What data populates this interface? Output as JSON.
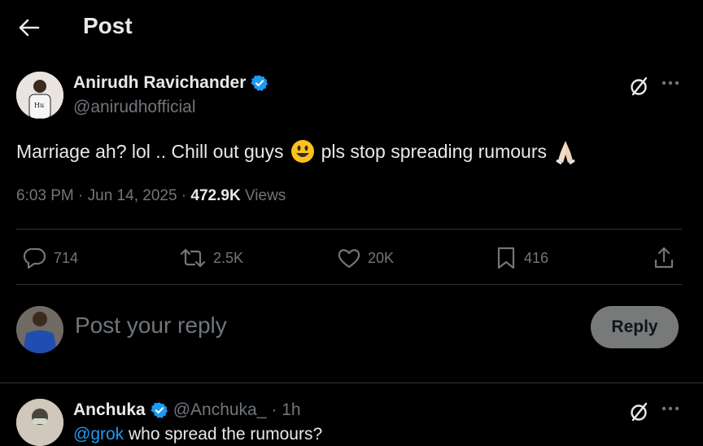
{
  "header": {
    "title": "Post",
    "back_icon": "arrow-left-icon"
  },
  "post": {
    "author_name": "Anirudh Ravichander",
    "author_handle": "@anirudhofficial",
    "verified": true,
    "text_part1": "Marriage ah? lol .. Chill out guys",
    "text_part2": "pls stop spreading rumours",
    "time": "6:03 PM · Jun 14, 2025 · ",
    "views_count": "472.9K",
    "views_label": " Views"
  },
  "actions": {
    "replies": "714",
    "reposts": "2.5K",
    "likes": "20K",
    "bookmarks": "416"
  },
  "reply_box": {
    "placeholder": "Post your reply",
    "button_label": "Reply"
  },
  "reply": {
    "name": "Anchuka",
    "handle": "@Anchuka_",
    "time": "· 1h",
    "mention": "@grok",
    "text": " who spread the rumours?"
  },
  "colors": {
    "accent": "#1d9bf0",
    "muted": "#71767b",
    "text": "#e7e9ea",
    "divider": "#2f3336"
  }
}
